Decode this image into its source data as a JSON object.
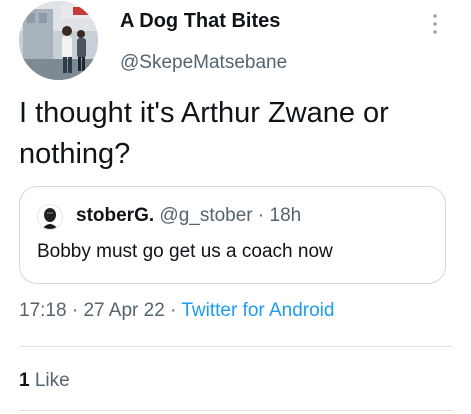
{
  "author": {
    "display_name": "A Dog That Bites",
    "handle": "@SkepeMatsebane"
  },
  "tweet": {
    "text_line1": "I thought it's Arthur Zwane or",
    "text_line2": "nothing?"
  },
  "quoted_tweet": {
    "display_name": "stoberG.",
    "handle": "@g_stober",
    "separator": "·",
    "age": "18h",
    "text": "Bobby must go get us a coach now"
  },
  "meta": {
    "time": "17:18",
    "separator1": "·",
    "date": "27 Apr 22",
    "separator2": "·",
    "source": "Twitter for Android"
  },
  "stats": {
    "like_count": "1",
    "like_label": "Like"
  },
  "colors": {
    "text_primary": "#0f1419",
    "text_secondary": "#536471",
    "link": "#1d9bf0",
    "border": "#cfd9de"
  },
  "icons": {
    "more": "more-vertical-icon"
  }
}
